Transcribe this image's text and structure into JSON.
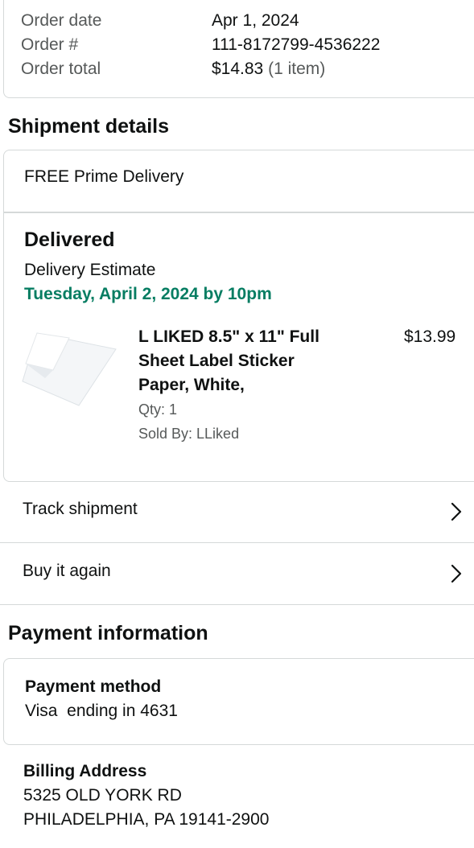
{
  "order_summary": {
    "rows": [
      {
        "label": "Order date",
        "value": "Apr 1, 2024"
      },
      {
        "label": "Order #",
        "value": "111-8172799-4536222"
      },
      {
        "label": "Order total",
        "value": "$14.83",
        "extra": "(1 item)"
      }
    ]
  },
  "shipment": {
    "section_title": "Shipment details",
    "delivery_type": "FREE Prime Delivery",
    "status": "Delivered",
    "estimate_label": "Delivery Estimate",
    "estimate_date": "Tuesday, April 2, 2024 by 10pm",
    "estimate_color": "#067d62",
    "item": {
      "title_lines": [
        "L LIKED 8.5\" x 11\" Full",
        "Sheet Label Sticker",
        "Paper, White,"
      ],
      "price": "$13.99",
      "qty": "Qty: 1",
      "sold_by": "Sold By: LLiked",
      "image_icon": "sticker-paper-sheet"
    }
  },
  "actions": [
    {
      "label": "Track shipment",
      "icon": "chevron-right-icon"
    },
    {
      "label": "Buy it again",
      "icon": "chevron-right-icon"
    }
  ],
  "payment": {
    "section_title": "Payment information",
    "method_title": "Payment method",
    "method_value": "Visa  ending in 4631",
    "billing_title": "Billing Address",
    "billing_lines": [
      "5325 OLD YORK RD",
      "PHILADELPHIA, PA 19141-2900"
    ]
  }
}
